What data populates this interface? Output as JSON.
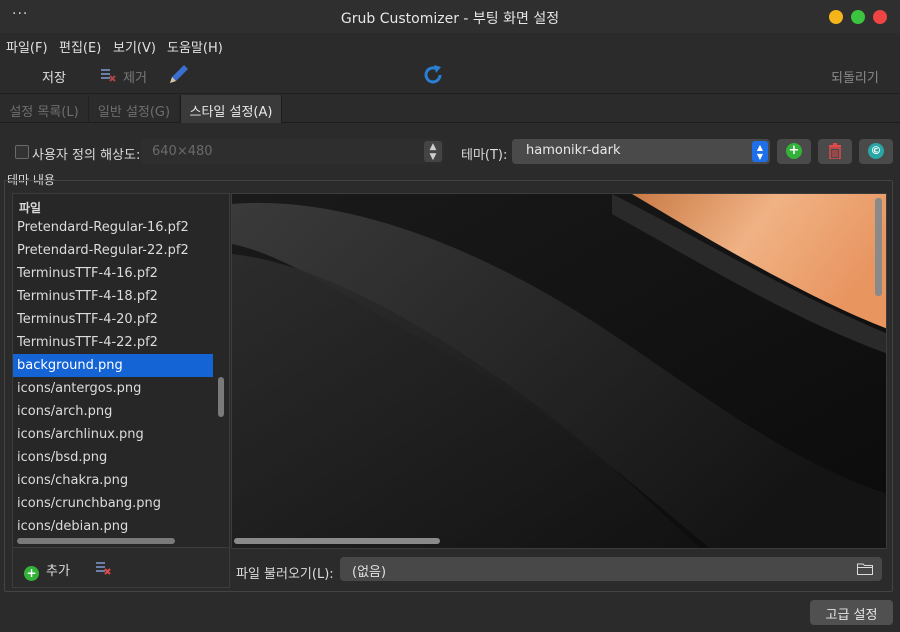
{
  "window": {
    "title": "Grub Customizer - 부팅 화면 설정",
    "menu_dots": "···"
  },
  "menu": {
    "file": "파일(F)",
    "edit": "편집(E)",
    "view": "보기(V)",
    "help": "도움말(H)"
  },
  "toolbar": {
    "save": "저장",
    "remove": "제거",
    "revert": "되돌리기"
  },
  "tabs": [
    "설정 목록(L)",
    "일반 설정(G)",
    "스타일 설정(A)"
  ],
  "resolution": {
    "label": "사용자 정의 해상도:",
    "value": "640×480",
    "checked": false
  },
  "theme": {
    "label": "테마(T):",
    "value": "hamonikr-dark"
  },
  "group_title": "테마 내용",
  "file_list": {
    "header": "파일",
    "items": [
      "Pretendard-Regular-16.pf2",
      "Pretendard-Regular-22.pf2",
      "TerminusTTF-4-16.pf2",
      "TerminusTTF-4-18.pf2",
      "TerminusTTF-4-20.pf2",
      "TerminusTTF-4-22.pf2",
      "background.png",
      "icons/antergos.png",
      "icons/arch.png",
      "icons/archlinux.png",
      "icons/bsd.png",
      "icons/chakra.png",
      "icons/crunchbang.png",
      "icons/debian.png"
    ],
    "selected_index": 6,
    "add_label": "추가"
  },
  "file_load": {
    "label": "파일 불러오기(L):",
    "value": "(없음)"
  },
  "advanced_button": "고급 설정",
  "colors": {
    "accent": "#1464d6",
    "add_green": "#33b23a",
    "delete_red": "#e04a4a",
    "copy_teal": "#2aa6a6",
    "refresh_blue": "#2a7fd4"
  }
}
